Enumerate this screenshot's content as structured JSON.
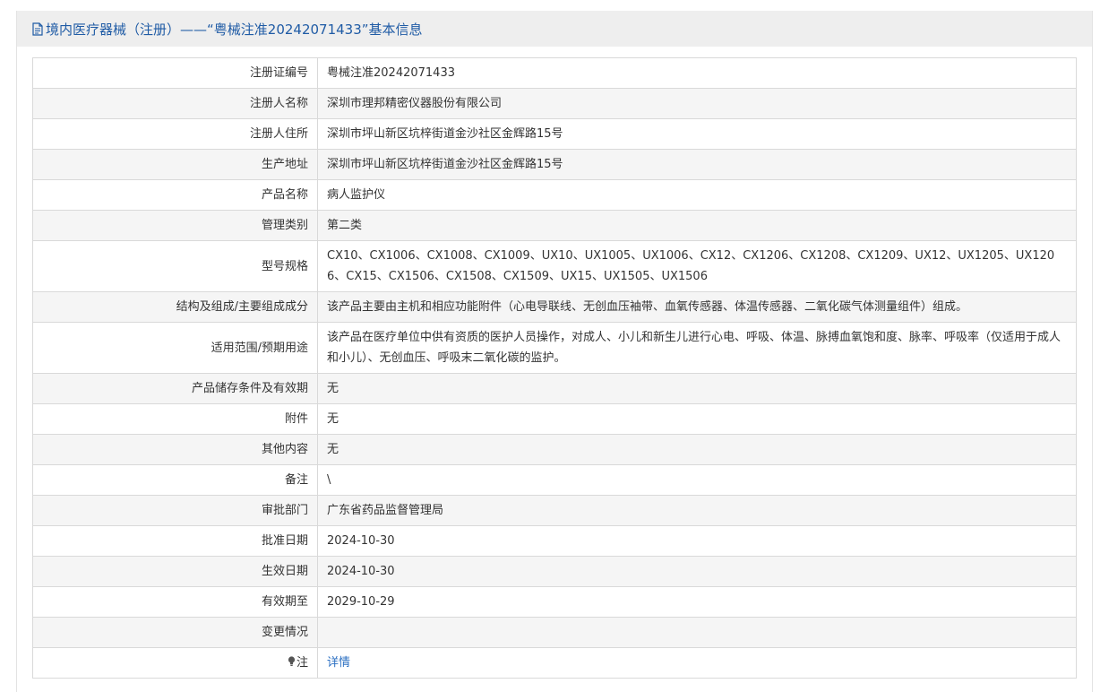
{
  "header": {
    "title": "境内医疗器械（注册）——“粤械注准20242071433”基本信息",
    "icon": "document-icon"
  },
  "rows": [
    {
      "label": "注册证编号",
      "value": "粤械注准20242071433"
    },
    {
      "label": "注册人名称",
      "value": "深圳市理邦精密仪器股份有限公司"
    },
    {
      "label": "注册人住所",
      "value": "深圳市坪山新区坑梓街道金沙社区金辉路15号"
    },
    {
      "label": "生产地址",
      "value": "深圳市坪山新区坑梓街道金沙社区金辉路15号"
    },
    {
      "label": "产品名称",
      "value": "病人监护仪"
    },
    {
      "label": "管理类别",
      "value": "第二类"
    },
    {
      "label": "型号规格",
      "value": "CX10、CX1006、CX1008、CX1009、UX10、UX1005、UX1006、CX12、CX1206、CX1208、CX1209、UX12、UX1205、UX1206、CX15、CX1506、CX1508、CX1509、UX15、UX1505、UX1506"
    },
    {
      "label": "结构及组成/主要组成成分",
      "value": "该产品主要由主机和相应功能附件（心电导联线、无创血压袖带、血氧传感器、体温传感器、二氧化碳气体测量组件）组成。"
    },
    {
      "label": "适用范围/预期用途",
      "value": "该产品在医疗单位中供有资质的医护人员操作，对成人、小儿和新生儿进行心电、呼吸、体温、脉搏血氧饱和度、脉率、呼吸率（仅适用于成人和小儿）、无创血压、呼吸末二氧化碳的监护。"
    },
    {
      "label": "产品储存条件及有效期",
      "value": "无"
    },
    {
      "label": "附件",
      "value": "无"
    },
    {
      "label": "其他内容",
      "value": "无"
    },
    {
      "label": "备注",
      "value": "\\"
    },
    {
      "label": "审批部门",
      "value": "广东省药品监督管理局"
    },
    {
      "label": "批准日期",
      "value": "2024-10-30"
    },
    {
      "label": "生效日期",
      "value": "2024-10-30"
    },
    {
      "label": "有效期至",
      "value": "2029-10-29"
    },
    {
      "label": "变更情况",
      "value": ""
    }
  ],
  "note": {
    "label": "注",
    "icon": "lightbulb-icon",
    "link": "详情"
  },
  "colors": {
    "title": "#1f5ba5",
    "link": "#2b6fc2",
    "stripe": "#f5f5f5",
    "border": "#d9d9d9"
  }
}
